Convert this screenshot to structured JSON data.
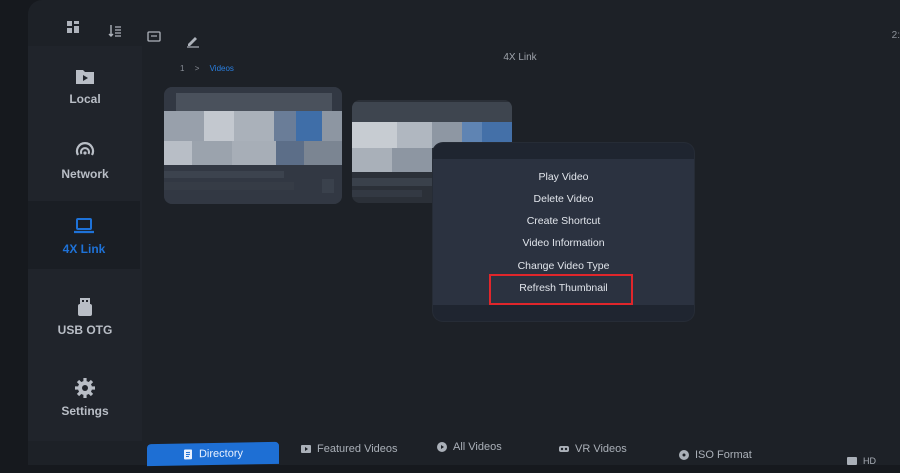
{
  "window": {
    "title": "4X Link",
    "clock": "2:"
  },
  "breadcrumb": {
    "root": "1",
    "separator": ">",
    "current": "Videos"
  },
  "sidebar": {
    "items": [
      {
        "label": "Local",
        "icon": "play-folder-icon",
        "active": false
      },
      {
        "label": "Network",
        "icon": "network-icon",
        "active": false
      },
      {
        "label": "4X Link",
        "icon": "laptop-icon",
        "active": true
      },
      {
        "label": "USB OTG",
        "icon": "usb-drive-icon",
        "active": false
      },
      {
        "label": "Settings",
        "icon": "gear-icon",
        "active": false
      }
    ]
  },
  "context_menu": {
    "items": [
      "Play Video",
      "Delete Video",
      "Create Shortcut",
      "Video Information",
      "Change Video Type",
      "Refresh Thumbnail"
    ],
    "highlighted": "Refresh Thumbnail"
  },
  "bottom_tabs": [
    {
      "label": "Directory",
      "icon": "document-icon",
      "active": true
    },
    {
      "label": "Featured Videos",
      "icon": "video-icon",
      "active": false
    },
    {
      "label": "All Videos",
      "icon": "play-circle-icon",
      "active": false
    },
    {
      "label": "VR Videos",
      "icon": "vr-icon",
      "active": false
    },
    {
      "label": "ISO Format",
      "icon": "disc-icon",
      "active": false
    },
    {
      "label": "HD",
      "icon": "hd-icon",
      "active": false
    }
  ],
  "colors": {
    "accent": "#1e72d8",
    "highlight": "#e0262b",
    "menu_bg": "#2b3240"
  }
}
